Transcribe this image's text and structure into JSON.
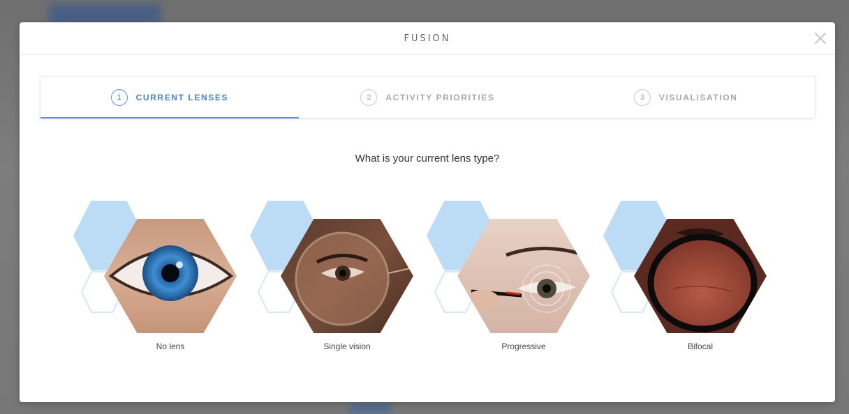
{
  "modal": {
    "title": "FUSION",
    "close_icon": "close-icon"
  },
  "stepper": {
    "steps": [
      {
        "number": "1",
        "label": "CURRENT LENSES",
        "active": true
      },
      {
        "number": "2",
        "label": "ACTIVITY PRIORITIES",
        "active": false
      },
      {
        "number": "3",
        "label": "VISUALISATION",
        "active": false
      }
    ]
  },
  "question": "What is your current lens type?",
  "options": [
    {
      "label": "No lens",
      "image": "blue-eye-closeup"
    },
    {
      "label": "Single vision",
      "image": "eye-through-round-glasses"
    },
    {
      "label": "Progressive",
      "image": "eye-with-lens-measurement"
    },
    {
      "label": "Bifocal",
      "image": "face-behind-black-frame-glasses"
    }
  ],
  "colors": {
    "accent": "#4a80cc",
    "hex_background": "#bcdcf6",
    "inactive_text": "#a8a8a8"
  }
}
